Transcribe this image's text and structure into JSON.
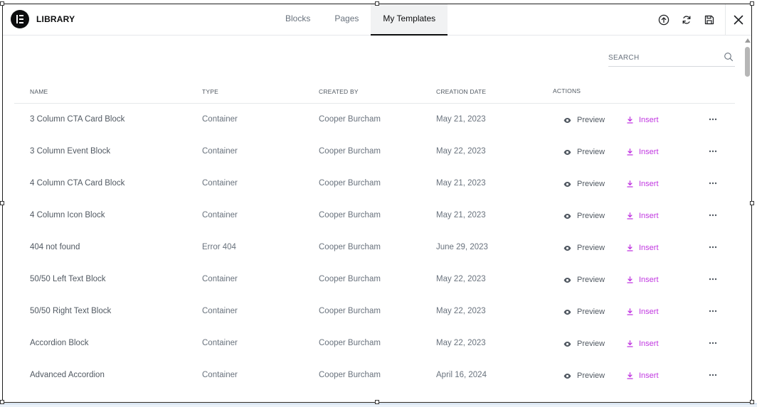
{
  "header": {
    "title": "LIBRARY",
    "tabs": [
      {
        "label": "Blocks"
      },
      {
        "label": "Pages"
      },
      {
        "label": "My Templates"
      }
    ],
    "icons": [
      "upload-icon",
      "sync-icon",
      "save-icon",
      "close-icon"
    ]
  },
  "search": {
    "placeholder": "SEARCH"
  },
  "table": {
    "columns": [
      "NAME",
      "TYPE",
      "CREATED BY",
      "CREATION DATE",
      "ACTIONS"
    ],
    "preview_label": "Preview",
    "insert_label": "Insert",
    "rows": [
      {
        "name": "3 Column CTA Card Block",
        "type": "Container",
        "created_by": "Cooper Burcham",
        "date": "May 21, 2023"
      },
      {
        "name": "3 Column Event Block",
        "type": "Container",
        "created_by": "Cooper Burcham",
        "date": "May 22, 2023"
      },
      {
        "name": "4 Column CTA Card Block",
        "type": "Container",
        "created_by": "Cooper Burcham",
        "date": "May 21, 2023"
      },
      {
        "name": "4 Column Icon Block",
        "type": "Container",
        "created_by": "Cooper Burcham",
        "date": "May 21, 2023"
      },
      {
        "name": "404 not found",
        "type": "Error 404",
        "created_by": "Cooper Burcham",
        "date": "June 29, 2023"
      },
      {
        "name": "50/50 Left Text Block",
        "type": "Container",
        "created_by": "Cooper Burcham",
        "date": "May 22, 2023"
      },
      {
        "name": "50/50 Right Text Block",
        "type": "Container",
        "created_by": "Cooper Burcham",
        "date": "May 22, 2023"
      },
      {
        "name": "Accordion Block",
        "type": "Container",
        "created_by": "Cooper Burcham",
        "date": "May 22, 2023"
      },
      {
        "name": "Advanced Accordion",
        "type": "Container",
        "created_by": "Cooper Burcham",
        "date": "April 16, 2024"
      }
    ]
  },
  "colors": {
    "accent": "#c036e0",
    "text": "#515962",
    "muted": "#69727d",
    "active_tab_bg": "#f1f2f3"
  }
}
